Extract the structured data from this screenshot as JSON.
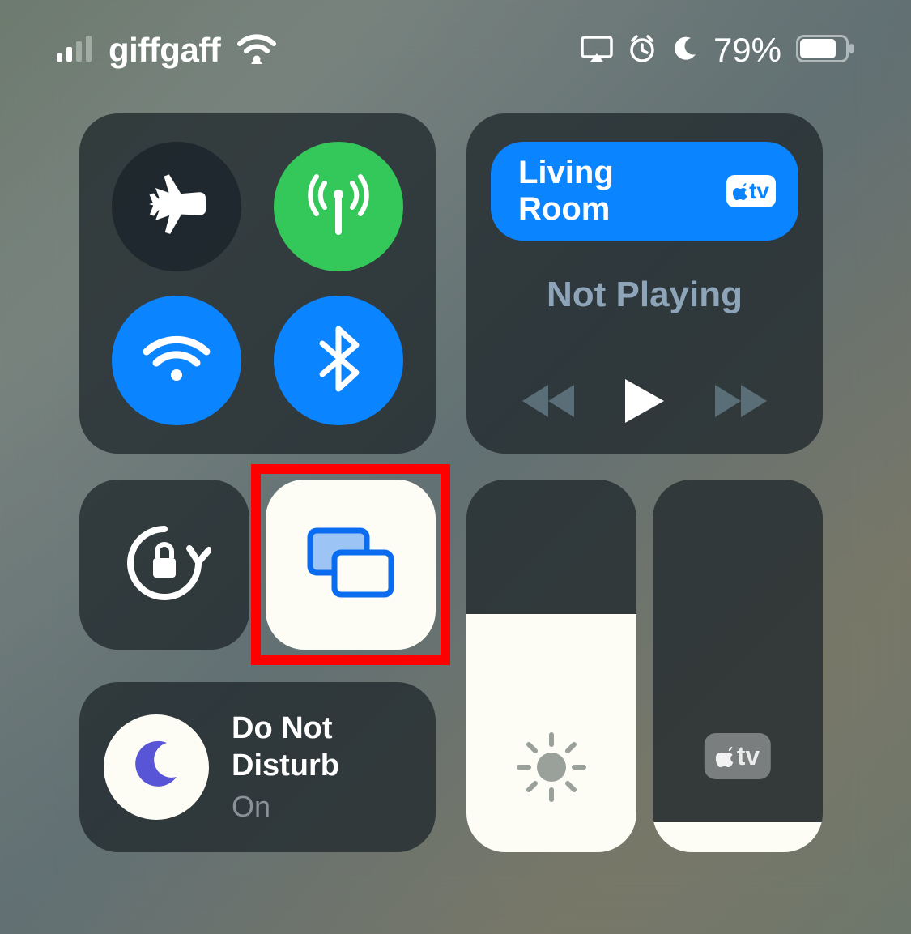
{
  "status": {
    "carrier": "giffgaff",
    "battery_pct": "79%"
  },
  "media": {
    "output_label": "Living Room",
    "status": "Not Playing"
  },
  "dnd": {
    "line1": "Do Not",
    "line2": "Disturb",
    "state": "On"
  },
  "brightness": {
    "level_pct": 64
  },
  "volume": {
    "level_pct": 8
  },
  "icons": {
    "atv_label": "tv"
  }
}
